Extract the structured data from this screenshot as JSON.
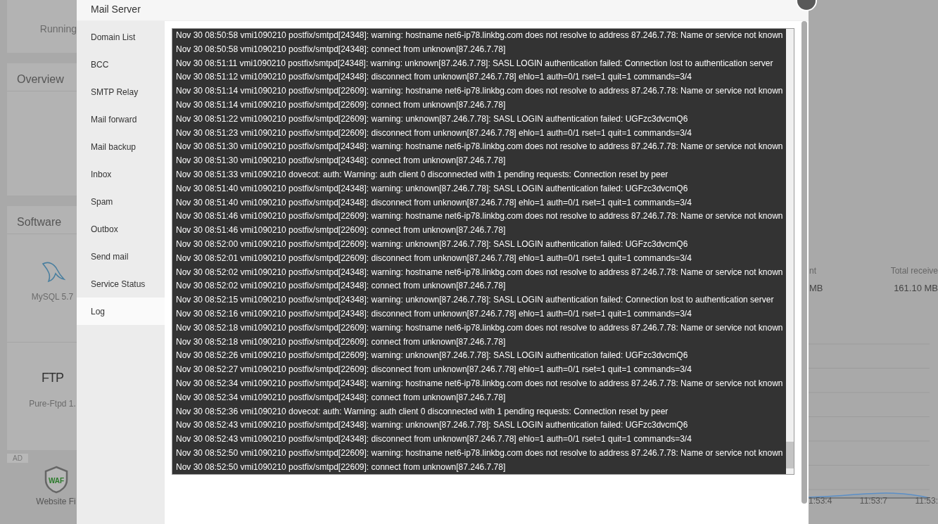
{
  "background": {
    "status": "Running",
    "overview_title": "Overview",
    "software_title": "Software",
    "software": [
      {
        "name": "MySQL 5.7",
        "kind": "mysql"
      },
      {
        "name": "Pure-Ftpd 1.",
        "kind": "ftp",
        "logo": "FTP"
      }
    ],
    "ad_label": "AD",
    "ad_app": {
      "badge": "WAF",
      "name": "Website Fi"
    },
    "traffic": [
      {
        "label": "nt",
        "value": "MB"
      },
      {
        "label": "Total receive",
        "value": "161.10 MB"
      }
    ],
    "time_ticks": [
      "1:53:4",
      "11:53:7",
      "11:53:"
    ]
  },
  "dialog": {
    "title": "Mail Server",
    "menu": [
      {
        "label": "Domain List",
        "selected": false
      },
      {
        "label": "BCC",
        "selected": false
      },
      {
        "label": "SMTP Relay",
        "selected": false
      },
      {
        "label": "Mail forward",
        "selected": false
      },
      {
        "label": "Mail backup",
        "selected": false
      },
      {
        "label": "Inbox",
        "selected": false
      },
      {
        "label": "Spam",
        "selected": false
      },
      {
        "label": "Outbox",
        "selected": false
      },
      {
        "label": "Send mail",
        "selected": false
      },
      {
        "label": "Service Status",
        "selected": false
      },
      {
        "label": "Log",
        "selected": true
      }
    ],
    "log_lines": [
      "Nov 30 08:50:58 vmi1090210 postfix/smtpd[24348]: warning: hostname net6-ip78.linkbg.com does not resolve to address 87.246.7.78: Name or service not known",
      "Nov 30 08:50:58 vmi1090210 postfix/smtpd[24348]: connect from unknown[87.246.7.78]",
      "Nov 30 08:51:11 vmi1090210 postfix/smtpd[24348]: warning: unknown[87.246.7.78]: SASL LOGIN authentication failed: Connection lost to authentication server",
      "Nov 30 08:51:12 vmi1090210 postfix/smtpd[24348]: disconnect from unknown[87.246.7.78] ehlo=1 auth=0/1 rset=1 quit=1 commands=3/4",
      "Nov 30 08:51:14 vmi1090210 postfix/smtpd[22609]: warning: hostname net6-ip78.linkbg.com does not resolve to address 87.246.7.78: Name or service not known",
      "Nov 30 08:51:14 vmi1090210 postfix/smtpd[22609]: connect from unknown[87.246.7.78]",
      "Nov 30 08:51:22 vmi1090210 postfix/smtpd[22609]: warning: unknown[87.246.7.78]: SASL LOGIN authentication failed: UGFzc3dvcmQ6",
      "Nov 30 08:51:23 vmi1090210 postfix/smtpd[22609]: disconnect from unknown[87.246.7.78] ehlo=1 auth=0/1 rset=1 quit=1 commands=3/4",
      "Nov 30 08:51:30 vmi1090210 postfix/smtpd[24348]: warning: hostname net6-ip78.linkbg.com does not resolve to address 87.246.7.78: Name or service not known",
      "Nov 30 08:51:30 vmi1090210 postfix/smtpd[24348]: connect from unknown[87.246.7.78]",
      "Nov 30 08:51:33 vmi1090210 dovecot: auth: Warning: auth client 0 disconnected with 1 pending requests: Connection reset by peer",
      "Nov 30 08:51:40 vmi1090210 postfix/smtpd[24348]: warning: unknown[87.246.7.78]: SASL LOGIN authentication failed: UGFzc3dvcmQ6",
      "Nov 30 08:51:40 vmi1090210 postfix/smtpd[24348]: disconnect from unknown[87.246.7.78] ehlo=1 auth=0/1 rset=1 quit=1 commands=3/4",
      "Nov 30 08:51:46 vmi1090210 postfix/smtpd[22609]: warning: hostname net6-ip78.linkbg.com does not resolve to address 87.246.7.78: Name or service not known",
      "Nov 30 08:51:46 vmi1090210 postfix/smtpd[22609]: connect from unknown[87.246.7.78]",
      "Nov 30 08:52:00 vmi1090210 postfix/smtpd[22609]: warning: unknown[87.246.7.78]: SASL LOGIN authentication failed: UGFzc3dvcmQ6",
      "Nov 30 08:52:01 vmi1090210 postfix/smtpd[22609]: disconnect from unknown[87.246.7.78] ehlo=1 auth=0/1 rset=1 quit=1 commands=3/4",
      "Nov 30 08:52:02 vmi1090210 postfix/smtpd[24348]: warning: hostname net6-ip78.linkbg.com does not resolve to address 87.246.7.78: Name or service not known",
      "Nov 30 08:52:02 vmi1090210 postfix/smtpd[24348]: connect from unknown[87.246.7.78]",
      "Nov 30 08:52:15 vmi1090210 postfix/smtpd[24348]: warning: unknown[87.246.7.78]: SASL LOGIN authentication failed: Connection lost to authentication server",
      "Nov 30 08:52:16 vmi1090210 postfix/smtpd[24348]: disconnect from unknown[87.246.7.78] ehlo=1 auth=0/1 rset=1 quit=1 commands=3/4",
      "Nov 30 08:52:18 vmi1090210 postfix/smtpd[22609]: warning: hostname net6-ip78.linkbg.com does not resolve to address 87.246.7.78: Name or service not known",
      "Nov 30 08:52:18 vmi1090210 postfix/smtpd[22609]: connect from unknown[87.246.7.78]",
      "Nov 30 08:52:26 vmi1090210 postfix/smtpd[22609]: warning: unknown[87.246.7.78]: SASL LOGIN authentication failed: UGFzc3dvcmQ6",
      "Nov 30 08:52:27 vmi1090210 postfix/smtpd[22609]: disconnect from unknown[87.246.7.78] ehlo=1 auth=0/1 rset=1 quit=1 commands=3/4",
      "Nov 30 08:52:34 vmi1090210 postfix/smtpd[24348]: warning: hostname net6-ip78.linkbg.com does not resolve to address 87.246.7.78: Name or service not known",
      "Nov 30 08:52:34 vmi1090210 postfix/smtpd[24348]: connect from unknown[87.246.7.78]",
      "Nov 30 08:52:36 vmi1090210 dovecot: auth: Warning: auth client 0 disconnected with 1 pending requests: Connection reset by peer",
      "Nov 30 08:52:43 vmi1090210 postfix/smtpd[24348]: warning: unknown[87.246.7.78]: SASL LOGIN authentication failed: UGFzc3dvcmQ6",
      "Nov 30 08:52:43 vmi1090210 postfix/smtpd[24348]: disconnect from unknown[87.246.7.78] ehlo=1 auth=0/1 rset=1 quit=1 commands=3/4",
      "Nov 30 08:52:50 vmi1090210 postfix/smtpd[22609]: warning: hostname net6-ip78.linkbg.com does not resolve to address 87.246.7.78: Name or service not known",
      "Nov 30 08:52:50 vmi1090210 postfix/smtpd[22609]: connect from unknown[87.246.7.78]"
    ]
  }
}
